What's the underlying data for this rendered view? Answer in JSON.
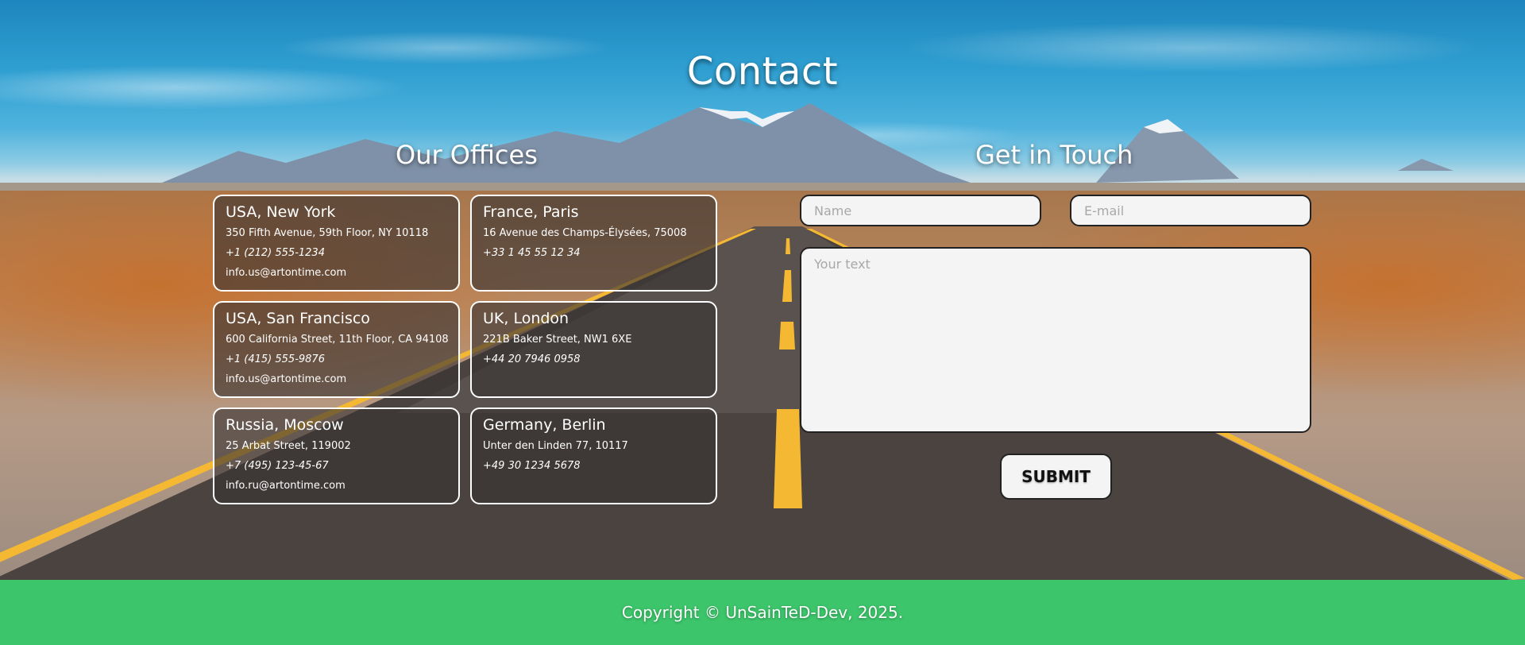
{
  "page": {
    "title": "Contact"
  },
  "offices": {
    "heading": "Our Offices",
    "items": [
      {
        "city": "USA, New York",
        "address": "350 Fifth Avenue, 59th Floor, NY 10118",
        "phone": "+1 (212) 555-1234",
        "email": "info.us@artontime.com"
      },
      {
        "city": "France, Paris",
        "address": "16 Avenue des Champs-Élysées, 75008",
        "phone": "+33 1 45 55 12 34",
        "email": ""
      },
      {
        "city": "USA, San Francisco",
        "address": "600 California Street, 11th Floor, CA 94108",
        "phone": "+1 (415) 555-9876",
        "email": "info.us@artontime.com"
      },
      {
        "city": "UK, London",
        "address": "221B Baker Street, NW1 6XE",
        "phone": "+44 20 7946 0958",
        "email": ""
      },
      {
        "city": "Russia, Moscow",
        "address": "25 Arbat Street, 119002",
        "phone": "+7 (495) 123-45-67",
        "email": "info.ru@artontime.com"
      },
      {
        "city": "Germany, Berlin",
        "address": "Unter den Linden 77, 10117",
        "phone": "+49 30 1234 5678",
        "email": ""
      }
    ]
  },
  "contact_form": {
    "heading": "Get in Touch",
    "name_placeholder": "Name",
    "email_placeholder": "E-mail",
    "message_placeholder": "Your text",
    "submit_label": "SUBMIT"
  },
  "footer": {
    "copyright": "Copyright © UnSainTeD-Dev, 2025."
  },
  "colors": {
    "footer_bg": "#3cc56a",
    "card_border": "#ffffff",
    "field_bg": "#f4f4f4"
  }
}
